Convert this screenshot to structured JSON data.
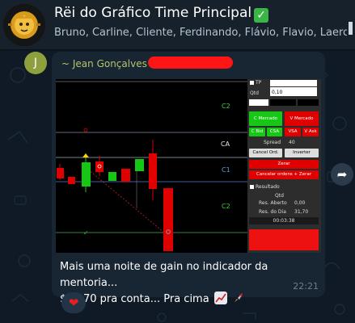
{
  "header": {
    "title": "Rëi do Gráfico Time Principal",
    "members": "Bruno, Carline, Cliente, Ferdinando, Flávio, Flavio, Laercio, Léo, P"
  },
  "message": {
    "avatar_letter": "J",
    "sender": "~ Jean Gonçalves",
    "text_line1": "Mais uma noite de gain no indicador da mentoria...",
    "text_line2": "$31,70 pra conta... Pra cima",
    "time": "22:21",
    "reaction": "❤"
  },
  "trading": {
    "levels": [
      "C2",
      "CA",
      "C1",
      "C2"
    ],
    "qty_label": "Qtd",
    "qty_value": "0,10",
    "tp_label": "TP",
    "c_mercado": "C Mercado",
    "v_mercado": "V Mercado",
    "c_bid": "C Bid",
    "csa": "CSA",
    "vsa": "VSA",
    "v_ask": "V Ask",
    "spread_label": "Spread",
    "spread_value": "40",
    "cancel_ord": "Cancel Ord.",
    "inverter": "Inverter",
    "zerar": "Zerar",
    "cancelar_zerar": "Cancelar ordens + Zerar",
    "resultado": "Resultado",
    "qtd_label": "Qtd",
    "res_aberto_label": "Res. Aberto",
    "res_aberto_value": "0,00",
    "res_dia_label": "Res. do Dia",
    "res_dia_value": "31,70",
    "timer": "00:03:38"
  },
  "colors": {
    "accent_green": "#16c716",
    "accent_red": "#e00000",
    "sender_color": "#b4c46c"
  }
}
